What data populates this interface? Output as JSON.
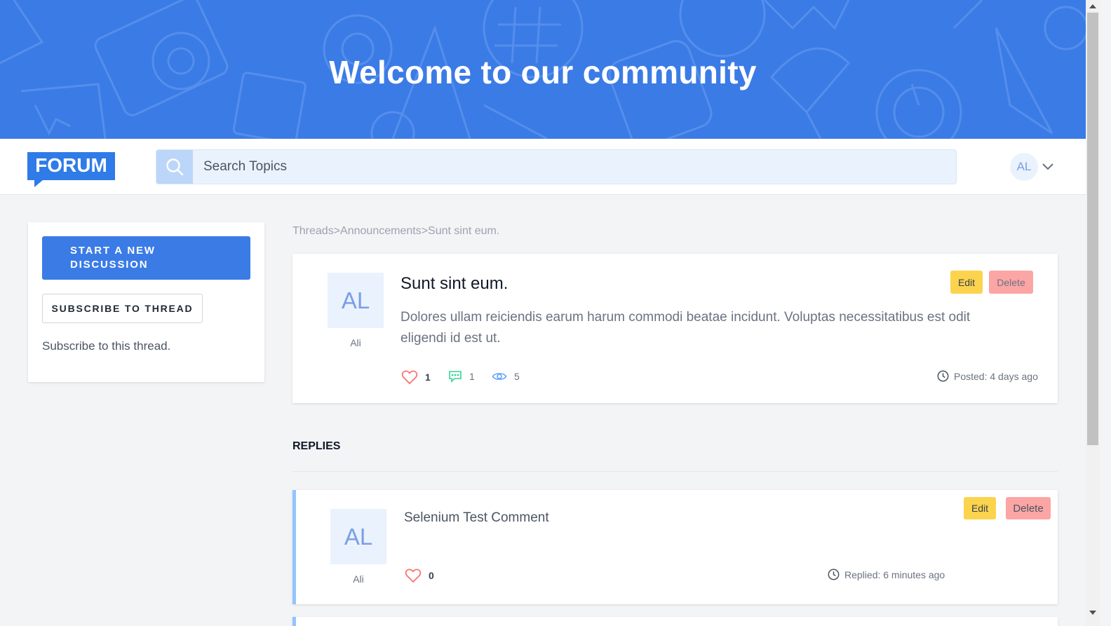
{
  "hero": {
    "title": "Welcome to our community"
  },
  "navbar": {
    "logo_text": "FORUM",
    "search_placeholder": "Search Topics",
    "user_initials": "AL"
  },
  "sidebar": {
    "start_discussion_label": "START A NEW DISCUSSION",
    "subscribe_label": "SUBSCRIBE TO THREAD",
    "subscribe_note": "Subscribe to this thread."
  },
  "breadcrumb": {
    "items": [
      "Threads",
      "Announcements",
      "Sunt sint eum."
    ],
    "separator": ">"
  },
  "thread": {
    "author_initials": "AL",
    "author_name": "Ali",
    "title": "Sunt sint eum.",
    "body": "Dolores ullam reiciendis earum harum commodi beatae incidunt. Voluptas necessitatibus est odit eligendi id est ut.",
    "edit_label": "Edit",
    "delete_label": "Delete",
    "likes": "1",
    "comments": "1",
    "views": "5",
    "posted": "Posted: 4 days ago"
  },
  "replies": {
    "heading": "REPLIES",
    "items": [
      {
        "author_initials": "AL",
        "author_name": "Ali",
        "text": "Selenium Test Comment",
        "likes": "0",
        "replied": "Replied: 6 minutes ago",
        "edit_label": "Edit",
        "delete_label": "Delete"
      }
    ]
  },
  "colors": {
    "primary": "#3b7be6",
    "edit": "#fcd34d",
    "delete": "#fca5a5",
    "like": "#f87171",
    "comment": "#34d399",
    "views": "#60a5fa"
  },
  "icons": [
    "search-icon",
    "chevron-down-icon",
    "heart-icon",
    "chat-icon",
    "eye-icon",
    "clock-icon"
  ]
}
